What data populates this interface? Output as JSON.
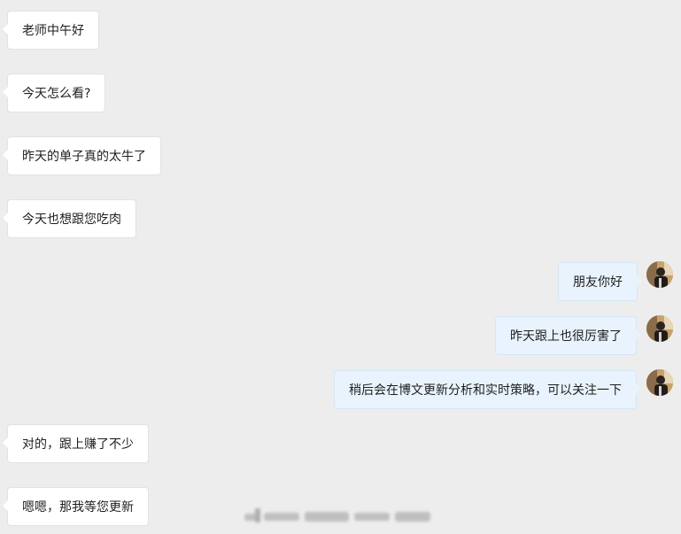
{
  "window": {
    "background_color": "#ededed"
  },
  "messages": [
    {
      "side": "left",
      "text": "老师中午好"
    },
    {
      "side": "left",
      "text": "今天怎么看?"
    },
    {
      "side": "left",
      "text": "昨天的单子真的太牛了"
    },
    {
      "side": "left",
      "text": "今天也想跟您吃肉"
    },
    {
      "side": "right",
      "text": "朋友你好"
    },
    {
      "side": "right",
      "text": "昨天跟上也很厉害了"
    },
    {
      "side": "right",
      "text": "稍后会在博文更新分析和实时策略，可以关注一下"
    },
    {
      "side": "left",
      "text": "对的，跟上赚了不少"
    },
    {
      "side": "left",
      "text": "嗯嗯，那我等您更新"
    }
  ],
  "colors": {
    "left_bubble": "#ffffff",
    "right_bubble": "#e8f3fd",
    "text": "#1f1f1f"
  },
  "icons": {
    "avatar": "user-avatar-icon",
    "watermark": "blurred-watermark"
  }
}
